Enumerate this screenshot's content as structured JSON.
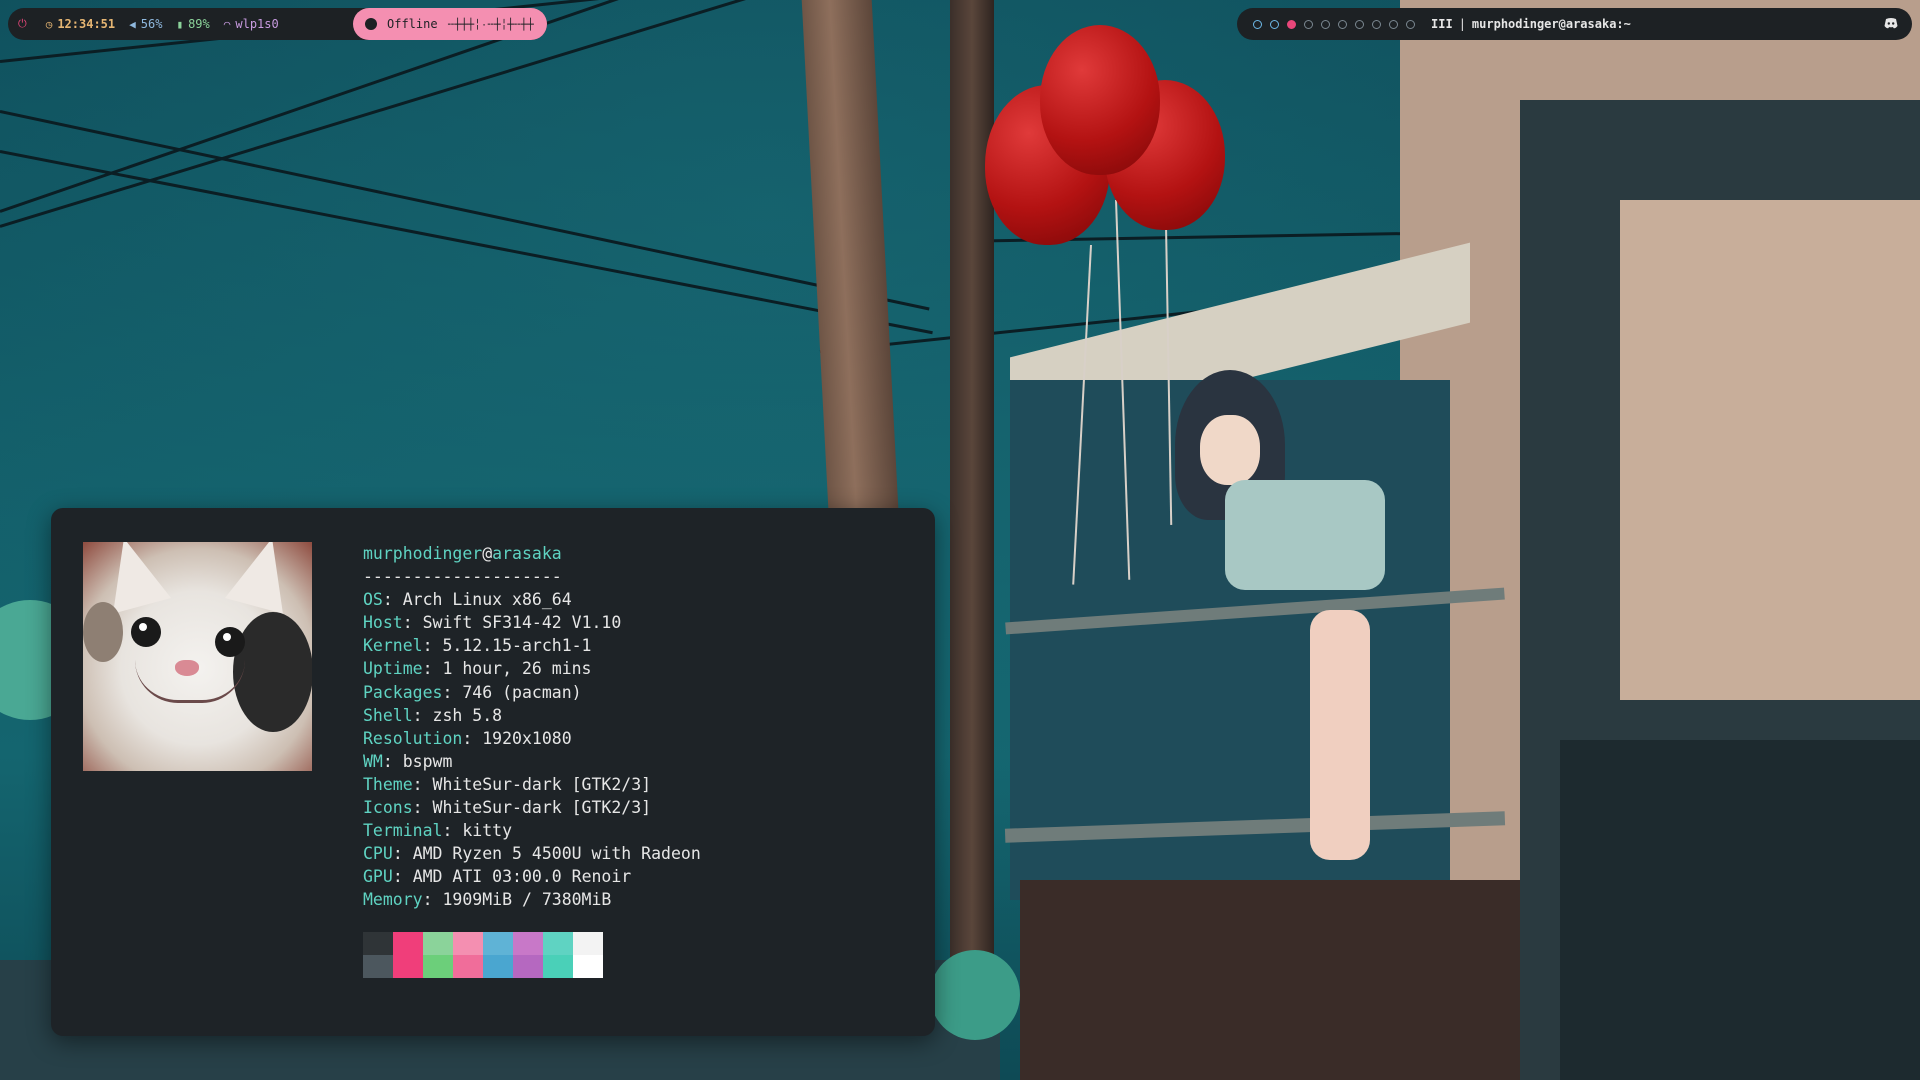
{
  "topbar_left": {
    "power_icon": "power-icon",
    "clock_icon": "clock-icon",
    "time": "12:34:51",
    "volume_icon": "volume-icon",
    "volume": "56%",
    "battery_icon": "battery-icon",
    "battery": "89%",
    "wifi_icon": "wifi-icon",
    "interface": "wlp1s0",
    "network_status": "Offline",
    "network_graph": "╌┼┼┼╎٠╌┼╎┼╌┼┼",
    "colors": {
      "time": "#e6b673",
      "volume": "#8fb8de",
      "battery": "#8bd39a",
      "wifi": "#c89be0",
      "power": "#e8477a"
    }
  },
  "topbar_right": {
    "workspaces": [
      {
        "state": "occupied"
      },
      {
        "state": "occupied"
      },
      {
        "state": "active"
      },
      {
        "state": "empty"
      },
      {
        "state": "empty"
      },
      {
        "state": "empty"
      },
      {
        "state": "empty"
      },
      {
        "state": "empty"
      },
      {
        "state": "empty"
      },
      {
        "state": "empty"
      }
    ],
    "layout": "III",
    "separator": "|",
    "window_title": "murphodinger@arasaka:~",
    "tray_icon": "discord-icon"
  },
  "terminal": {
    "user": "murphodinger",
    "at": "@",
    "host": "arasaka",
    "divider": "--------------------",
    "fields": [
      {
        "key": "OS",
        "value": "Arch Linux x86_64"
      },
      {
        "key": "Host",
        "value": "Swift SF314-42 V1.10"
      },
      {
        "key": "Kernel",
        "value": "5.12.15-arch1-1"
      },
      {
        "key": "Uptime",
        "value": "1 hour, 26 mins"
      },
      {
        "key": "Packages",
        "value": "746 (pacman)"
      },
      {
        "key": "Shell",
        "value": "zsh 5.8"
      },
      {
        "key": "Resolution",
        "value": "1920x1080"
      },
      {
        "key": "WM",
        "value": "bspwm"
      },
      {
        "key": "Theme",
        "value": "WhiteSur-dark [GTK2/3]"
      },
      {
        "key": "Icons",
        "value": "WhiteSur-dark [GTK2/3]"
      },
      {
        "key": "Terminal",
        "value": "kitty"
      },
      {
        "key": "CPU",
        "value": "AMD Ryzen 5 4500U with Radeon"
      },
      {
        "key": "GPU",
        "value": "AMD ATI 03:00.0 Renoir"
      },
      {
        "key": "Memory",
        "value": "1909MiB / 7380MiB"
      }
    ],
    "separator": ": ",
    "palette_top": [
      "#2f3437",
      "#f03e7a",
      "#8bd39a",
      "#f48fb1",
      "#5fb3d6",
      "#c878c8",
      "#5fd3c2",
      "#f3f3f3"
    ],
    "palette_bottom": [
      "#4c575e",
      "#f03e7a",
      "#6ccf7a",
      "#f06d9a",
      "#4aa6d0",
      "#b568c0",
      "#4ad0b8",
      "#ffffff"
    ]
  }
}
